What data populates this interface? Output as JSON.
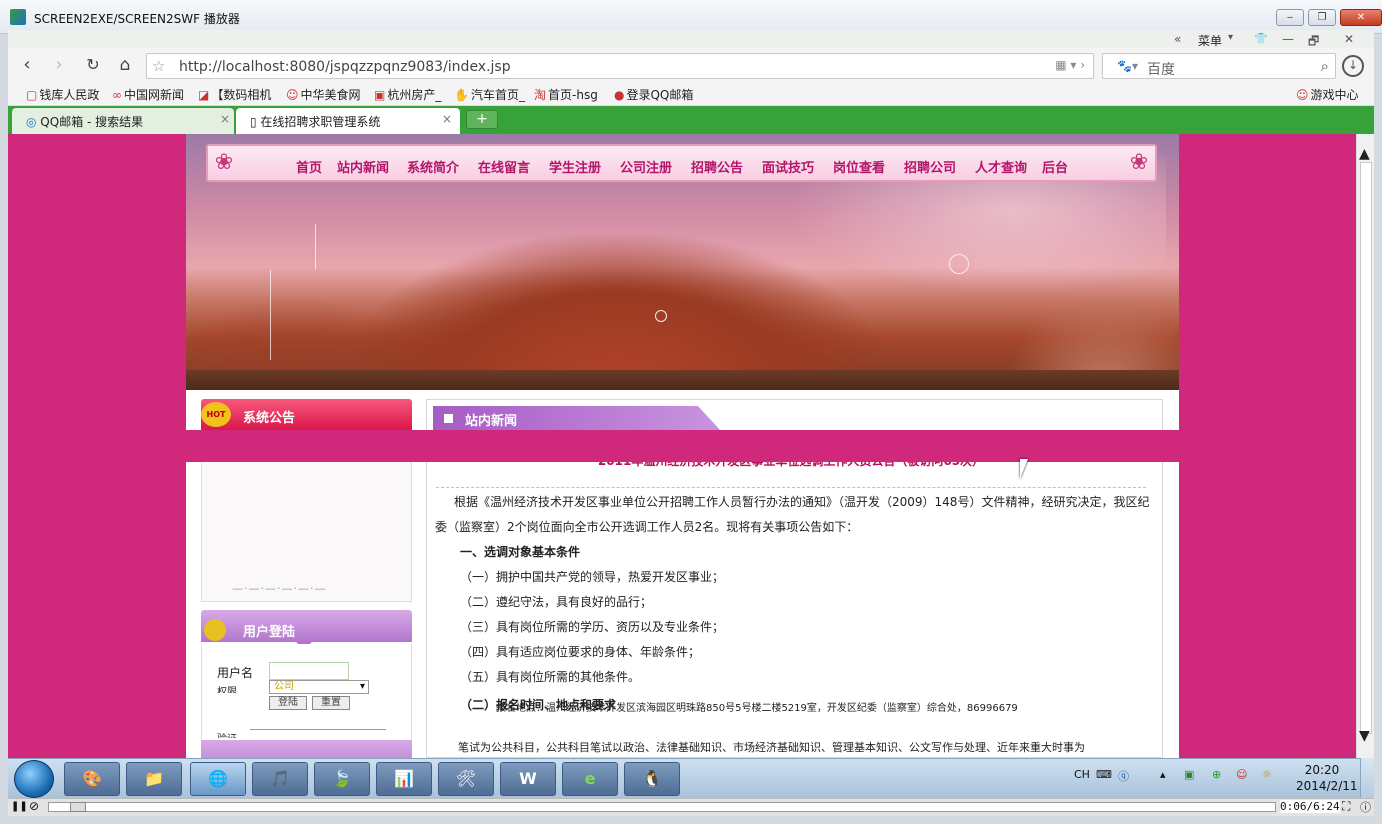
{
  "window": {
    "title": "SCREEN2EXE/SCREEN2SWF 播放器",
    "min": "‒",
    "max": "❐",
    "close": "✕"
  },
  "browser": {
    "top_controls": {
      "collapse": "«",
      "menu": "菜单",
      "menu_caret": "▾",
      "shirt": "👕",
      "min": "—",
      "restore": "🗗",
      "close": "✕"
    },
    "url": "http://localhost:8080/jspqzzpqnz9083/index.jsp",
    "url_right_icons": "▦ ▾ ›",
    "search_placeholder": "百度",
    "search_engine_icon": "🐾▾",
    "bookmarks": [
      {
        "icon": "▢",
        "label": "钱库人民政"
      },
      {
        "icon": "∞",
        "label": "中国网新闻"
      },
      {
        "icon": "◪",
        "label": "【数码相机"
      },
      {
        "icon": "☺",
        "label": "中华美食网"
      },
      {
        "icon": "▣",
        "label": "杭州房产_"
      },
      {
        "icon": "✋",
        "label": "汽车首页_"
      },
      {
        "icon": "淘",
        "label": "首页-hsg"
      },
      {
        "icon": "●",
        "label": "登录QQ邮箱"
      }
    ],
    "game_center": "游戏中心",
    "tabs": [
      {
        "label": "QQ邮箱 - 搜索结果",
        "close": "×"
      },
      {
        "label": "在线招聘求职管理系统",
        "close": "×"
      }
    ],
    "new_tab": "+"
  },
  "site": {
    "nav": [
      "首页",
      "站内新闻",
      "系统简介",
      "在线留言",
      "学生注册",
      "公司注册",
      "招聘公告",
      "面试技巧",
      "岗位查看",
      "招聘公司",
      "人才查询",
      "后台"
    ],
    "announcement": {
      "hot": "HOT",
      "title": "系统公告"
    },
    "login": {
      "title": "用户登陆",
      "username_label": "用户名",
      "role_label": "权限",
      "role_value": "公司",
      "login_button": "登陆",
      "reset_button": "重置",
      "code_label": "验证"
    },
    "news": {
      "title": "站内新闻",
      "article_title": "2011年温州经济技术开发区事业单位选调工作人员公告（被访问65次）",
      "paragraphs": [
        "根据《温州经济技术开发区事业单位公开招聘工作人员暂行办法的通知》（温开发（2009）148号）文件精神，经研究决定，我区纪",
        "委（监察室）2个岗位面向全市公开选调工作人员2名。现将有关事项公告如下：",
        "一、选调对象基本条件",
        "（一）拥护中国共产党的领导，热爱开发区事业；",
        "（二）遵纪守法，具有良好的品行；",
        "（三）具有岗位所需的学历、资历以及专业条件；",
        "（四）具有适应岗位要求的身体、年龄条件；",
        "（五）具有岗位所需的其他条件。",
        "（二）报名时间、地点和要求",
        "报名地点：温州经济技术开发区滨海园区明珠路850号5号楼二楼5219室，开发区纪委（监察室）综合处，86996679",
        "笔试为公共科目，公共科目笔试以政治、法律基础知识、市场经济基础知识、管理基本知识、公文写作与处理、近年来重大时事为"
      ]
    }
  },
  "taskbar": {
    "icons": [
      "🎨",
      "📁",
      "🌐",
      "🎵",
      "🍃",
      "📊",
      "🛠",
      "W",
      "e",
      "🐧"
    ],
    "ime": "CH",
    "time": "20:20",
    "date": "2014/2/11"
  },
  "player": {
    "pause": "❚❚",
    "time": "0:06/6:24"
  }
}
